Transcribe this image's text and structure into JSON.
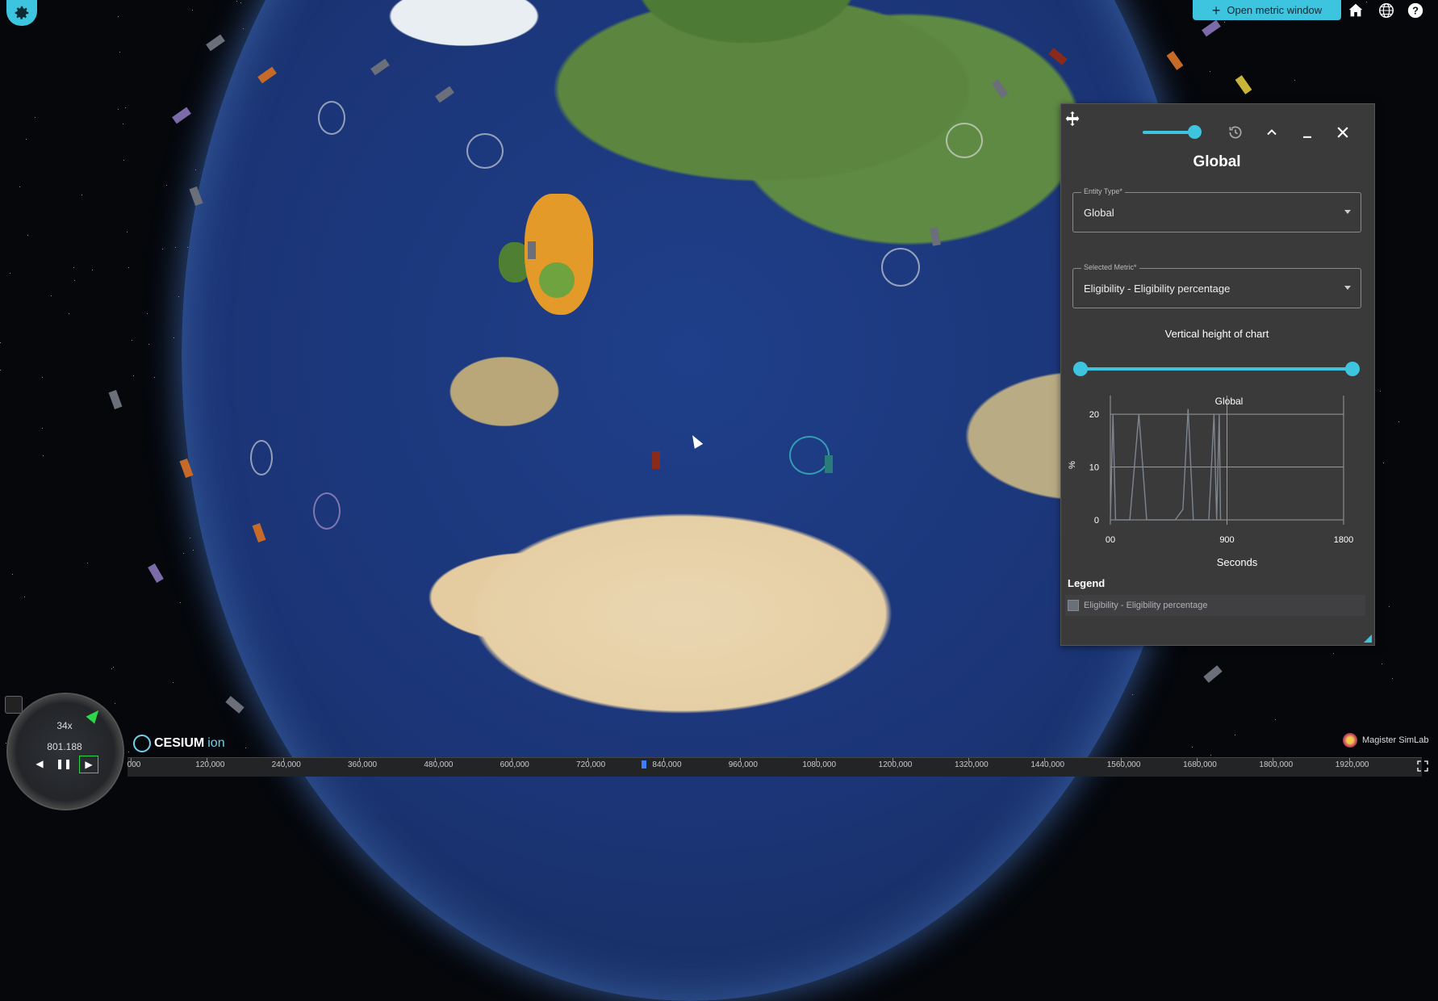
{
  "toolbar": {
    "open_metric_label": "Open metric window",
    "icons": [
      "home-icon",
      "globe-icon",
      "help-icon"
    ]
  },
  "settings": {
    "icon": "gear-icon"
  },
  "panel": {
    "title": "Global",
    "opacity_slider_value": 0.85,
    "entity_type": {
      "label": "Entity Type*",
      "value": "Global"
    },
    "selected_metric": {
      "label": "Selected Metric*",
      "value": "Eligibility - Eligibility percentage"
    },
    "vertical_height_label": "Vertical height of chart",
    "vertical_height_range": [
      0,
      1
    ],
    "legend": {
      "title": "Legend",
      "items": [
        "Eligibility - Eligibility percentage"
      ]
    }
  },
  "chart_data": {
    "type": "line",
    "title": "Global",
    "xlabel": "Seconds",
    "ylabel": "%",
    "xlim": [
      0,
      1800
    ],
    "ylim": [
      0,
      22
    ],
    "x_ticks": [
      "00",
      "900",
      "1800"
    ],
    "y_ticks": [
      "0",
      "10",
      "20"
    ],
    "grid": true,
    "series": [
      {
        "name": "Eligibility - Eligibility percentage",
        "x": [
          0,
          20,
          40,
          60,
          150,
          220,
          280,
          320,
          500,
          560,
          600,
          640,
          720,
          760,
          800,
          820,
          840,
          850
        ],
        "y": [
          0,
          20,
          0,
          0,
          0,
          20,
          0,
          0,
          0,
          2,
          21,
          0,
          0,
          0,
          20,
          0,
          20,
          0
        ]
      }
    ]
  },
  "clock": {
    "speed": "34x",
    "time": "801.188"
  },
  "branding": {
    "cesium": "CESIUM",
    "cesium_ion": "ion",
    "app": "Magister SimLab"
  },
  "timeline": {
    "labels": [
      "000",
      "120,000",
      "240,000",
      "360,000",
      "480,000",
      "600,000",
      "720,000",
      "840,000",
      "960,000",
      "1080,000",
      "1200,000",
      "1320,000",
      "1440,000",
      "1560,000",
      "1680,000",
      "1800,000",
      "1920,000"
    ]
  }
}
